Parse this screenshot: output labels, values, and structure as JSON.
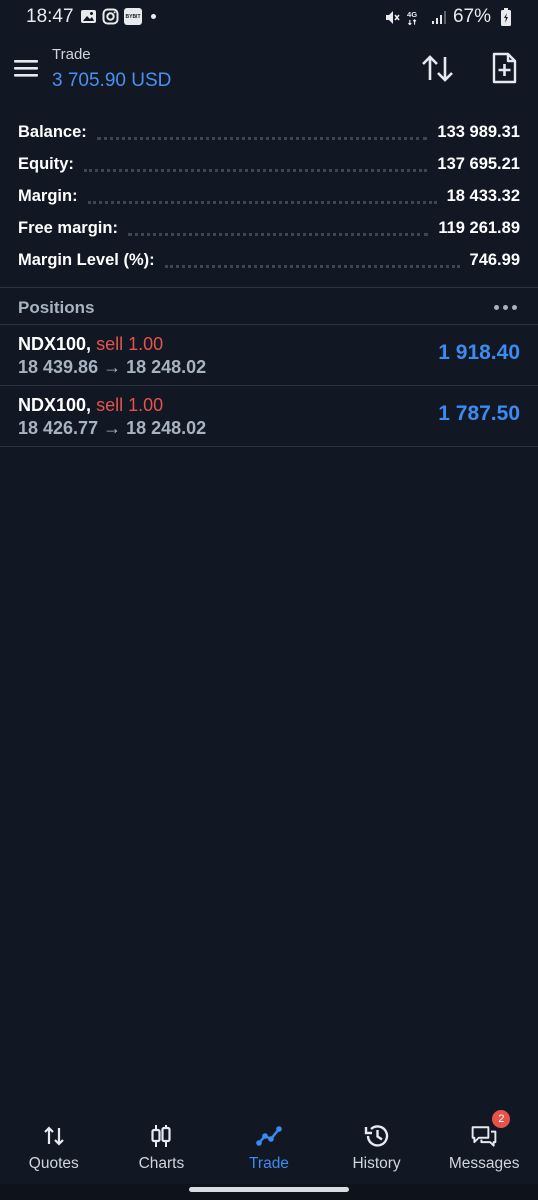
{
  "status_bar": {
    "time": "18:47",
    "left_icons": [
      "gallery-icon",
      "instagram-icon",
      "bybit-icon",
      "notification-dot"
    ],
    "bybit_text": "BYBIT",
    "network": "4G",
    "battery": "67%"
  },
  "header": {
    "title": "Trade",
    "amount": "3 705.90 USD"
  },
  "summary": [
    {
      "label": "Balance:",
      "value": "133 989.31"
    },
    {
      "label": "Equity:",
      "value": "137 695.21"
    },
    {
      "label": "Margin:",
      "value": "18 433.32"
    },
    {
      "label": "Free margin:",
      "value": "119 261.89"
    },
    {
      "label": "Margin Level (%):",
      "value": "746.99"
    }
  ],
  "positions": {
    "title": "Positions",
    "items": [
      {
        "symbol": "NDX100",
        "side": "sell 1.00",
        "prices": "18 439.86 → 18 248.02",
        "profit": "1 918.40"
      },
      {
        "symbol": "NDX100",
        "side": "sell 1.00",
        "prices": "18 426.77 → 18 248.02",
        "profit": "1 787.50"
      }
    ]
  },
  "nav": {
    "items": [
      {
        "label": "Quotes",
        "icon": "quotes-icon"
      },
      {
        "label": "Charts",
        "icon": "charts-icon"
      },
      {
        "label": "Trade",
        "icon": "trade-icon",
        "active": true
      },
      {
        "label": "History",
        "icon": "history-icon"
      },
      {
        "label": "Messages",
        "icon": "messages-icon",
        "badge": "2"
      }
    ]
  },
  "colors": {
    "background": "#111823",
    "accent": "#3b8bf0",
    "sell": "#e5534b",
    "muted": "#a8b3c1"
  }
}
